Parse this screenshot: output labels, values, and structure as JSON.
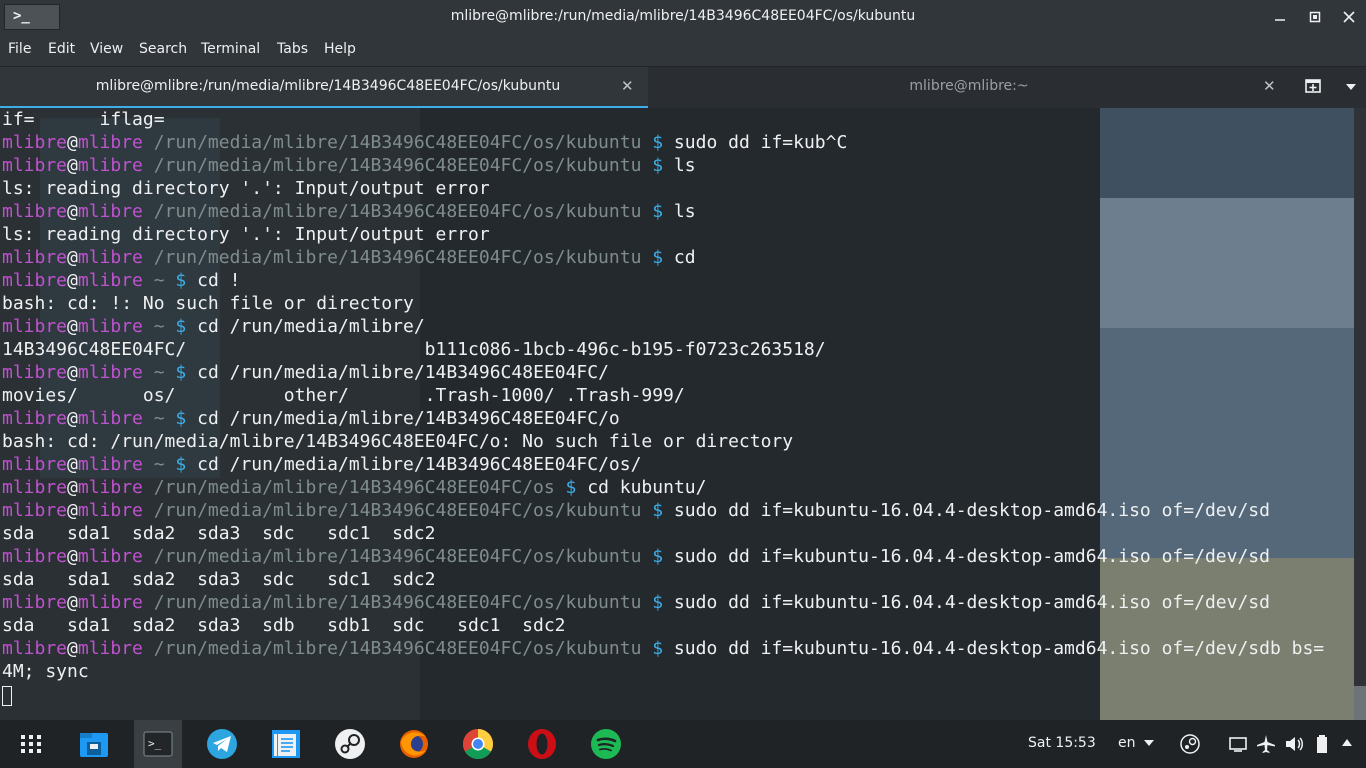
{
  "window": {
    "title": "mlibre@mlibre:/run/media/mlibre/14B3496C48EE04FC/os/kubuntu",
    "app_icon_label": ">_"
  },
  "menu": [
    "File",
    "Edit",
    "View",
    "Search",
    "Terminal",
    "Tabs",
    "Help"
  ],
  "tabs": [
    {
      "label": "mlibre@mlibre:/run/media/mlibre/14B3496C48EE04FC/os/kubuntu",
      "active": true
    },
    {
      "label": "mlibre@mlibre:~",
      "active": false
    }
  ],
  "terminal": {
    "lines": [
      {
        "out": "if=      iflag="
      },
      {
        "user": "mlibre",
        "host": "mlibre",
        "path": "/run/media/mlibre/14B3496C48EE04FC/os/kubuntu",
        "cmd": "sudo dd if=kub^C"
      },
      {
        "user": "mlibre",
        "host": "mlibre",
        "path": "/run/media/mlibre/14B3496C48EE04FC/os/kubuntu",
        "cmd": "ls"
      },
      {
        "out": "ls: reading directory '.': Input/output error"
      },
      {
        "user": "mlibre",
        "host": "mlibre",
        "path": "/run/media/mlibre/14B3496C48EE04FC/os/kubuntu",
        "cmd": "ls"
      },
      {
        "out": "ls: reading directory '.': Input/output error"
      },
      {
        "user": "mlibre",
        "host": "mlibre",
        "path": "/run/media/mlibre/14B3496C48EE04FC/os/kubuntu",
        "cmd": "cd"
      },
      {
        "user": "mlibre",
        "host": "mlibre",
        "path": "~",
        "cmd": "cd !"
      },
      {
        "out": "bash: cd: !: No such file or directory"
      },
      {
        "user": "mlibre",
        "host": "mlibre",
        "path": "~",
        "cmd": "cd /run/media/mlibre/"
      },
      {
        "out": "14B3496C48EE04FC/                      b111c086-1bcb-496c-b195-f0723c263518/"
      },
      {
        "user": "mlibre",
        "host": "mlibre",
        "path": "~",
        "cmd": "cd /run/media/mlibre/14B3496C48EE04FC/"
      },
      {
        "out": "movies/      os/          other/       .Trash-1000/ .Trash-999/"
      },
      {
        "user": "mlibre",
        "host": "mlibre",
        "path": "~",
        "cmd": "cd /run/media/mlibre/14B3496C48EE04FC/o"
      },
      {
        "out": "bash: cd: /run/media/mlibre/14B3496C48EE04FC/o: No such file or directory"
      },
      {
        "user": "mlibre",
        "host": "mlibre",
        "path": "~",
        "cmd": "cd /run/media/mlibre/14B3496C48EE04FC/os/"
      },
      {
        "user": "mlibre",
        "host": "mlibre",
        "path": "/run/media/mlibre/14B3496C48EE04FC/os",
        "cmd": "cd kubuntu/"
      },
      {
        "user": "mlibre",
        "host": "mlibre",
        "path": "/run/media/mlibre/14B3496C48EE04FC/os/kubuntu",
        "cmd": "sudo dd if=kubuntu-16.04.4-desktop-amd64.iso of=/dev/sd"
      },
      {
        "out": "sda   sda1  sda2  sda3  sdc   sdc1  sdc2"
      },
      {
        "user": "mlibre",
        "host": "mlibre",
        "path": "/run/media/mlibre/14B3496C48EE04FC/os/kubuntu",
        "cmd": "sudo dd if=kubuntu-16.04.4-desktop-amd64.iso of=/dev/sd"
      },
      {
        "out": "sda   sda1  sda2  sda3  sdc   sdc1  sdc2"
      },
      {
        "user": "mlibre",
        "host": "mlibre",
        "path": "/run/media/mlibre/14B3496C48EE04FC/os/kubuntu",
        "cmd": "sudo dd if=kubuntu-16.04.4-desktop-amd64.iso of=/dev/sd"
      },
      {
        "out": "sda   sda1  sda2  sda3  sdb   sdb1  sdc   sdc1  sdc2"
      },
      {
        "user": "mlibre",
        "host": "mlibre",
        "path": "/run/media/mlibre/14B3496C48EE04FC/os/kubuntu",
        "cmd": "sudo dd if=kubuntu-16.04.4-desktop-amd64.iso of=/dev/sdb bs="
      },
      {
        "out": "4M; sync"
      }
    ]
  },
  "taskbar": {
    "apps": [
      "app-launcher",
      "file-manager",
      "terminal",
      "telegram",
      "text-editor",
      "steam",
      "firefox",
      "chrome",
      "opera",
      "spotify"
    ],
    "clock": "Sat 15:53",
    "language": "en"
  },
  "colors": {
    "accent": "#3daee9",
    "user": "#c052cf",
    "path": "#7f8c8d"
  }
}
